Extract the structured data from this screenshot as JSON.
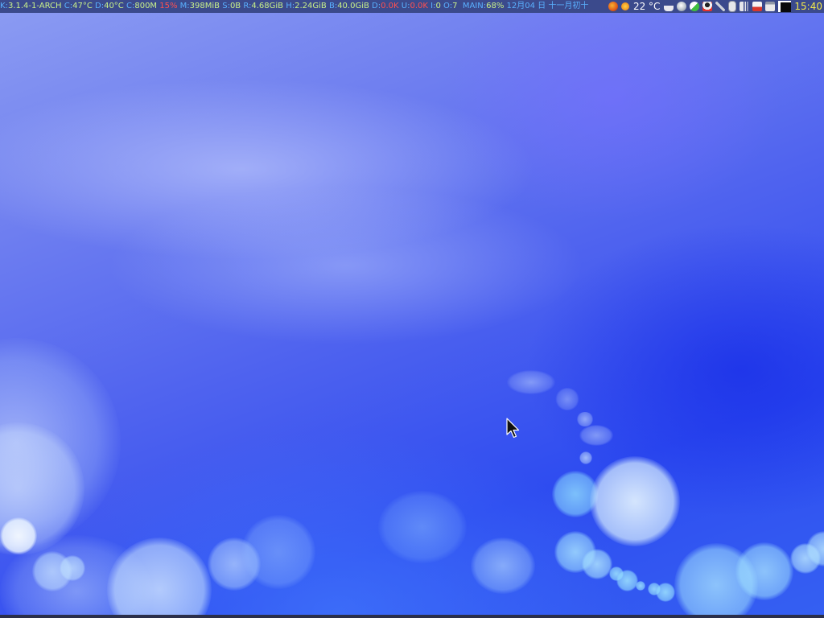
{
  "statusbar": {
    "kernel": {
      "key": "K:",
      "value": "3.1.4-1-ARCH"
    },
    "cpu_temp": {
      "key": "C:",
      "value": "47°C"
    },
    "disk_temp": {
      "key": "D:",
      "value": "40°C"
    },
    "cpu_freq": {
      "key": "C:",
      "value": "800M"
    },
    "cpu_load": {
      "value": "15%"
    },
    "memory": {
      "key": "M:",
      "value": "398MiB"
    },
    "swap": {
      "key": "S:",
      "value": "0B"
    },
    "root_fs": {
      "key": "R:",
      "value": "4.68GiB"
    },
    "home_fs": {
      "key": "H:",
      "value": "2.24GiB"
    },
    "backup_fs": {
      "key": "B:",
      "value": "40.0GiB"
    },
    "download": {
      "key": "D:",
      "value": "0.0K"
    },
    "upload": {
      "key": "U:",
      "value": "0.0K"
    },
    "io_in": {
      "key": "I:",
      "value": "0"
    },
    "io_out": {
      "key": "O:",
      "value": "7"
    },
    "volume": {
      "key": "MAIN:",
      "value": "68%"
    },
    "date": {
      "value": "12月04 日 十一月初十"
    }
  },
  "tray": {
    "icons": [
      "firefox-icon",
      "weather-sun-icon",
      "teacup-icon",
      "network-globe-icon",
      "chat-status-icon",
      "qq-penguin-icon",
      "pen-icon",
      "mouse-icon",
      "volume-icon",
      "notes-icon",
      "clipboard-icon",
      "workspace-pager-icon"
    ],
    "weather_temp": "22 °C",
    "clock": "15:40"
  },
  "colors": {
    "bar_background": "#3b4a8c",
    "label_blue": "#5ab0ff",
    "value_green": "#c8f08a",
    "warning_red": "#ff5050",
    "clock_yellow": "#f2e84a"
  }
}
